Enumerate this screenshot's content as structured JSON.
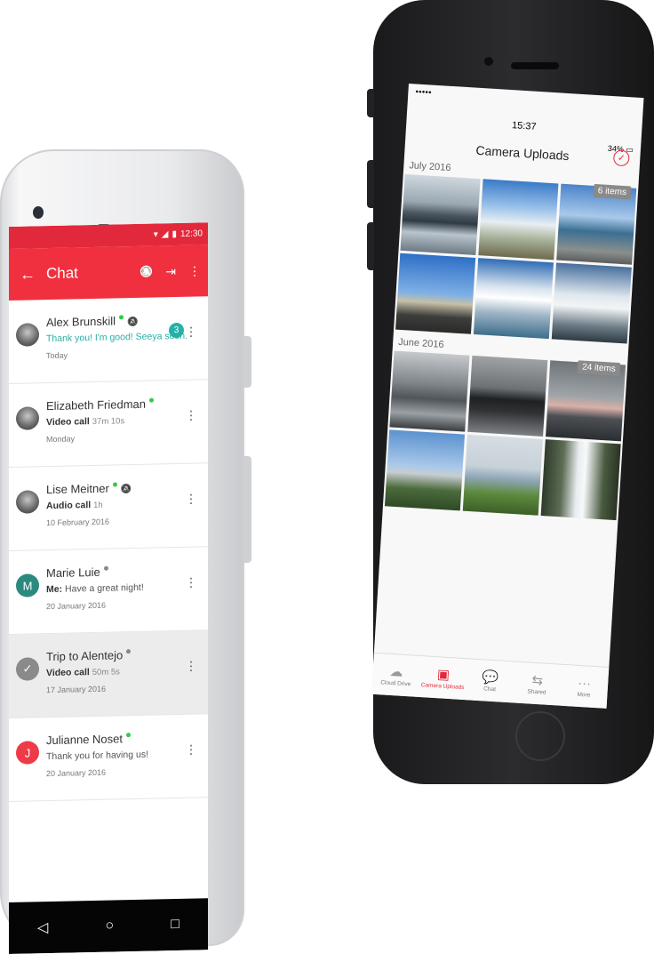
{
  "android": {
    "status_time": "12:30",
    "toolbar": {
      "title": "Chat",
      "back_icon": "←",
      "mute_icon": "🔕",
      "leave_icon": "⇥",
      "more_icon": "⋮"
    },
    "chats": [
      {
        "name": "Alex Brunskill",
        "message": "Thank you! I'm good! Seeya soon.",
        "prefix": "",
        "duration": "",
        "date": "Today",
        "status_color": "#2ecc4a",
        "muted": true,
        "unread": "3",
        "avatar_letter": "",
        "avatar_color": ""
      },
      {
        "name": "Elizabeth Friedman",
        "message": "",
        "prefix": "Video call",
        "duration": "37m 10s",
        "date": "Monday",
        "status_color": "#2ecc4a",
        "muted": false,
        "unread": "",
        "avatar_letter": "",
        "avatar_color": ""
      },
      {
        "name": "Lise Meitner",
        "message": "",
        "prefix": "Audio call",
        "duration": "1h",
        "date": "10 February 2016",
        "status_color": "#2ecc4a",
        "muted": true,
        "unread": "",
        "avatar_letter": "",
        "avatar_color": ""
      },
      {
        "name": "Marie Luie",
        "message": "Have a great night!",
        "prefix": "Me:",
        "duration": "",
        "date": "20 January 2016",
        "status_color": "#888888",
        "muted": false,
        "unread": "",
        "avatar_letter": "M",
        "avatar_color": "#2b8a7e"
      },
      {
        "name": "Trip to Alentejo",
        "message": "",
        "prefix": "Video call",
        "duration": "50m 5s",
        "date": "17 January 2016",
        "status_color": "#888888",
        "muted": false,
        "unread": "",
        "avatar_letter": "✓",
        "avatar_color": "#8a8a8a"
      },
      {
        "name": "Julianne Noset",
        "message": "Thank you for having us!",
        "prefix": "",
        "duration": "",
        "date": "20 January 2016",
        "status_color": "#2ecc4a",
        "muted": false,
        "unread": "",
        "avatar_letter": "J",
        "avatar_color": "#ef3a47"
      }
    ],
    "nav": {
      "back": "◁",
      "home": "○",
      "recents": "□"
    }
  },
  "iphone": {
    "signal": "●●●●● ",
    "time": "15:37",
    "battery": "34%",
    "title": "Camera Uploads",
    "check_icon": "✓",
    "sections": [
      {
        "title": "July 2016",
        "count_label": "6 items"
      },
      {
        "title": "June 2016",
        "count_label": "24 items"
      }
    ],
    "tabs": [
      {
        "label": "Cloud Drive",
        "icon": "☁"
      },
      {
        "label": "Camera Uploads",
        "icon": "▣"
      },
      {
        "label": "Chat",
        "icon": "💬"
      },
      {
        "label": "Shared",
        "icon": "⇆"
      },
      {
        "label": "More",
        "icon": "···"
      }
    ]
  },
  "colors": {
    "accent": "#f0303f",
    "teal": "#26b0a6"
  }
}
